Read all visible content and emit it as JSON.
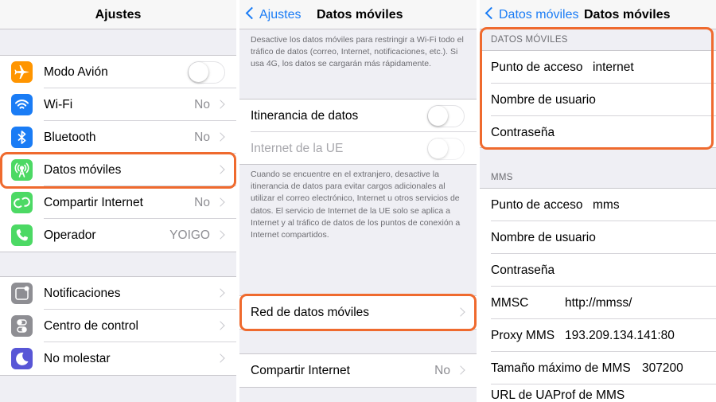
{
  "settings": {
    "title": "Ajustes",
    "items": [
      {
        "label": "Modo Avión",
        "value": "",
        "icon": "airplane-icon",
        "icon_color": "#ff9500",
        "control": "toggle"
      },
      {
        "label": "Wi-Fi",
        "value": "No",
        "icon": "wifi-icon",
        "icon_color": "#1a7cf5",
        "control": "chevron"
      },
      {
        "label": "Bluetooth",
        "value": "No",
        "icon": "bluetooth-icon",
        "icon_color": "#1a7cf5",
        "control": "chevron"
      },
      {
        "label": "Datos móviles",
        "value": "",
        "icon": "cellular-antenna-icon",
        "icon_color": "#4cd964",
        "control": "chevron"
      },
      {
        "label": "Compartir Internet",
        "value": "No",
        "icon": "personal-hotspot-icon",
        "icon_color": "#4cd964",
        "control": "chevron"
      },
      {
        "label": "Operador",
        "value": "YOIGO",
        "icon": "phone-icon",
        "icon_color": "#4cd964",
        "control": "chevron"
      },
      {
        "label": "Notificaciones",
        "value": "",
        "icon": "notifications-icon",
        "icon_color": "#8e8e93",
        "control": "chevron"
      },
      {
        "label": "Centro de control",
        "value": "",
        "icon": "control-center-icon",
        "icon_color": "#8e8e93",
        "control": "chevron"
      },
      {
        "label": "No molestar",
        "value": "",
        "icon": "moon-icon",
        "icon_color": "#5856d6",
        "control": "chevron"
      }
    ]
  },
  "cellular": {
    "back_label": "Ajustes",
    "title": "Datos móviles",
    "intro_note": "Desactive los datos móviles para restringir a Wi-Fi todo el tráfico de datos (correo, Internet, notificaciones, etc.). Si usa 4G, los datos se cargarán más rápidamente.",
    "roaming_label": "Itinerancia de datos",
    "eu_internet_label": "Internet de la UE",
    "roaming_note": "Cuando se encuentre en el extranjero, desactive la itinerancia de datos para evitar cargos adicionales al utilizar el correo electrónico, Internet u otros servicios de datos. El servicio de Internet de la UE solo se aplica a Internet y al tráfico de datos de los puntos de conexión a Internet compartidos.",
    "network_label": "Red de datos móviles",
    "hotspot_label": "Compartir Internet",
    "hotspot_value": "No"
  },
  "network": {
    "back_label": "Datos móviles",
    "title": "Datos móviles",
    "data_section_header": "DATOS MÓVILES",
    "data_rows": [
      {
        "label": "Punto de acceso",
        "value": "internet"
      },
      {
        "label": "Nombre de usuario",
        "value": ""
      },
      {
        "label": "Contraseña",
        "value": ""
      }
    ],
    "mms_section_header": "MMS",
    "mms_rows": [
      {
        "label": "Punto de acceso",
        "value": "mms"
      },
      {
        "label": "Nombre de usuario",
        "value": ""
      },
      {
        "label": "Contraseña",
        "value": ""
      },
      {
        "label": "MMSC",
        "value": "http://mmss/"
      },
      {
        "label": "Proxy MMS",
        "value": "193.209.134.141:80"
      },
      {
        "label": "Tamaño máximo de MMS",
        "value": "307200"
      },
      {
        "label": "URL de UAProf de MMS",
        "value": ""
      }
    ]
  },
  "colors": {
    "accent": "#1a7cf5",
    "highlight": "#ef6a2e"
  }
}
